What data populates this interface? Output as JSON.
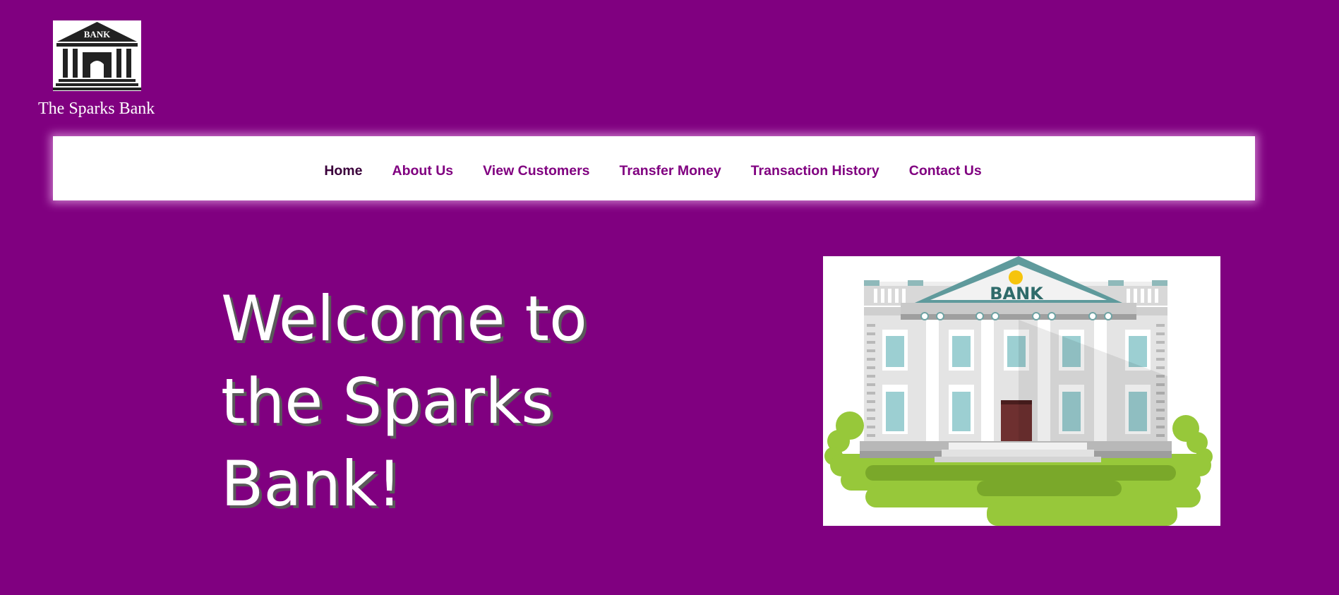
{
  "brand": {
    "logo_text": "BANK",
    "name": "The Sparks Bank"
  },
  "nav": {
    "items": [
      {
        "label": "Home"
      },
      {
        "label": "About Us"
      },
      {
        "label": "View Customers"
      },
      {
        "label": "Transfer Money"
      },
      {
        "label": "Transaction History"
      },
      {
        "label": "Contact Us"
      }
    ]
  },
  "hero": {
    "heading_lines": [
      "Welcome to",
      "the Sparks",
      "Bank!"
    ],
    "image_sign": "BANK"
  },
  "colors": {
    "background": "#800080",
    "nav_background": "#ffffff",
    "nav_text": "#800080",
    "hero_text": "#ffffff",
    "building_roof": "#5f9a9c",
    "grass": "#97c83a"
  }
}
